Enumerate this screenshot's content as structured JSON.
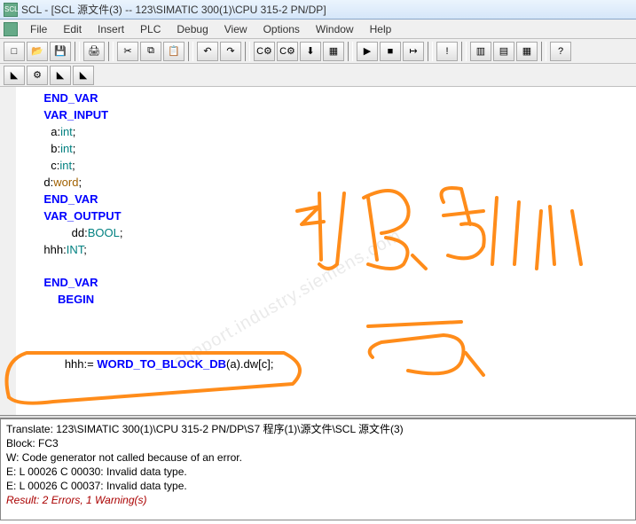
{
  "window": {
    "title": "SCL  - [SCL 源文件(3) -- 123\\SIMATIC 300(1)\\CPU 315-2 PN/DP]"
  },
  "menu": {
    "file": "File",
    "edit": "Edit",
    "insert": "Insert",
    "plc": "PLC",
    "debug": "Debug",
    "view": "View",
    "options": "Options",
    "window": "Window",
    "help": "Help"
  },
  "toolbar_icons": {
    "new": "□",
    "open": "📂",
    "save": "💾",
    "print": "🖨",
    "cut": "✂",
    "copy": "⧉",
    "paste": "📋",
    "undo": "↶",
    "redo": "↷",
    "compile1": "C⚙",
    "compile2": "C⚙",
    "download": "⬇",
    "block": "▦",
    "run": "▶",
    "stop": "■",
    "step": "↦",
    "goto": "!",
    "win1": "▥",
    "win2": "▤",
    "win3": "▦",
    "help": "?"
  },
  "toolbar2_icons": {
    "b1": "◣",
    "b2": "⚙",
    "b3": "◣",
    "b4": "◣"
  },
  "code": {
    "l1_kw": "END_VAR",
    "l2_kw": "VAR_INPUT",
    "l3_v": "a:",
    "l3_t": "int",
    "l3_e": ";",
    "l4_v": "b:",
    "l4_t": "int",
    "l4_e": ";",
    "l5_v": "c:",
    "l5_t": "int",
    "l5_e": ";",
    "l6_v": "d:",
    "l6_t": "word",
    "l6_e": ";",
    "l7_kw": "END_VAR",
    "l8_kw": "VAR_OUTPUT",
    "l9_v": "dd:",
    "l9_t": "BOOL",
    "l9_e": ";",
    "l10_v": "hhh:",
    "l10_t": "INT",
    "l10_e": ";",
    "l12_kw": "END_VAR",
    "l13_kw": "BEGIN",
    "l17_v": "hhh",
    "l17_op": ":= ",
    "l17_fn": "WORD_TO_BLOCK_DB",
    "l17_rest": "(a).dw[c];"
  },
  "output": {
    "l1": "Translate: 123\\SIMATIC 300(1)\\CPU 315-2 PN/DP\\S7 程序(1)\\源文件\\SCL 源文件(3)",
    "l2": "Block: FC3",
    "l3": "W: Code generator not called because of an error.",
    "l4": "E: L 00026 C 00030: Invalid data type.",
    "l5": "E: L 00026 C 00037: Invalid data type.",
    "l6": "Result: 2 Errors, 1 Warning(s)"
  },
  "watermark": "support.industry.siemens.com"
}
